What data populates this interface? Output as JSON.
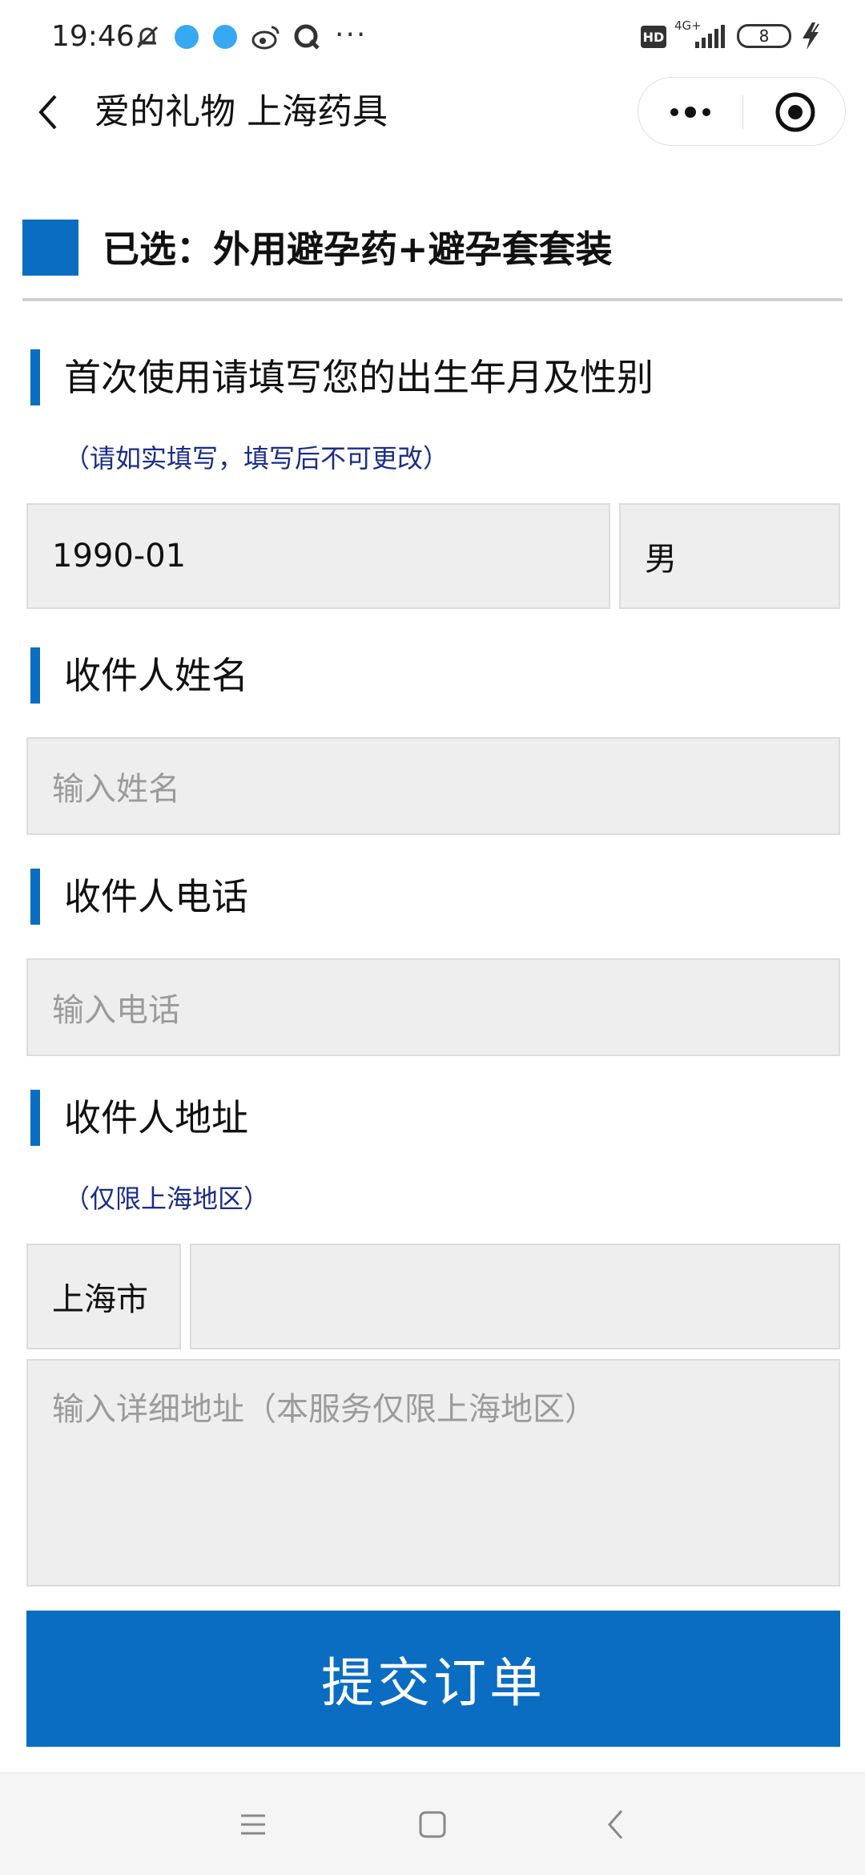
{
  "status_bar": {
    "time": "19:46",
    "more": "···",
    "hd": "HD",
    "network": "4G+",
    "battery": "8",
    "icons": [
      "bell-mute-icon",
      "bubble-icon",
      "bubble-icon",
      "weibo-icon",
      "q-icon",
      "signal-icon",
      "battery-icon",
      "charging-icon"
    ]
  },
  "nav": {
    "title": "爱的礼物 上海药具"
  },
  "selected": {
    "label": "已选：外用避孕药+避孕套套装"
  },
  "birth_section": {
    "title": "首次使用请填写您的出生年月及性别",
    "note": "（请如实填写，填写后不可更改）",
    "birth_value": "1990-01",
    "gender_value": "男"
  },
  "name_section": {
    "title": "收件人姓名",
    "placeholder": "输入姓名"
  },
  "phone_section": {
    "title": "收件人电话",
    "placeholder": "输入电话"
  },
  "address_section": {
    "title": "收件人地址",
    "note": "（仅限上海地区）",
    "city_value": "上海市",
    "district_value": "",
    "detail_placeholder": "输入详细地址（本服务仅限上海地区）"
  },
  "submit_label": "提交订单",
  "colors": {
    "accent": "#0a6dc2",
    "field_bg": "#eeeeee",
    "note_text": "#1a2d8a"
  }
}
